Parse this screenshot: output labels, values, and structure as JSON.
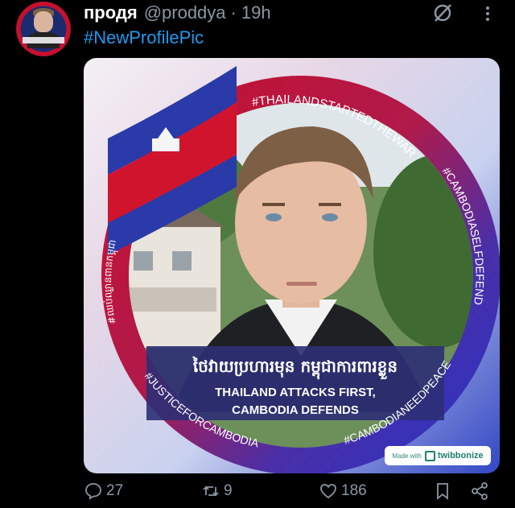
{
  "post": {
    "display_name": "продя",
    "handle": "@proddya",
    "separator": "·",
    "time": "19h",
    "text": "#NewProfilePic"
  },
  "avatar": {
    "image_text": "Thailand attacks first, Cambodia defends"
  },
  "media": {
    "frame_hashtags": {
      "top": "#THAILANDSTARTEDTHEWAR",
      "right": "#CAMBODIASELFDEFEND",
      "left": "#ឈប់ឈ្លានពានកម្ពុជា",
      "bottom_left": "#JUSTICEFORCAMBODIA",
      "bottom_right": "#CAMBODIANEEDPEACE"
    },
    "khmer_caption": "ថៃវាយប្រហារមុន កម្ពុជាការពារខ្លួន",
    "caption_line1": "THAILAND ATTACKS FIRST,",
    "caption_line2": "CAMBODIA DEFENDS",
    "badge_made_with": "Made with",
    "badge_brand": "twibbonize"
  },
  "actions": {
    "replies": "27",
    "reposts": "9",
    "likes": "186"
  },
  "colors": {
    "background": "#000000",
    "link": "#1d9bf0",
    "muted": "#8b98a5",
    "frame_red": "#c8102e",
    "frame_blue": "#2434a8"
  },
  "icons": [
    "grok-icon",
    "more-icon",
    "reply-icon",
    "repost-icon",
    "like-icon",
    "bookmark-icon",
    "share-icon"
  ]
}
